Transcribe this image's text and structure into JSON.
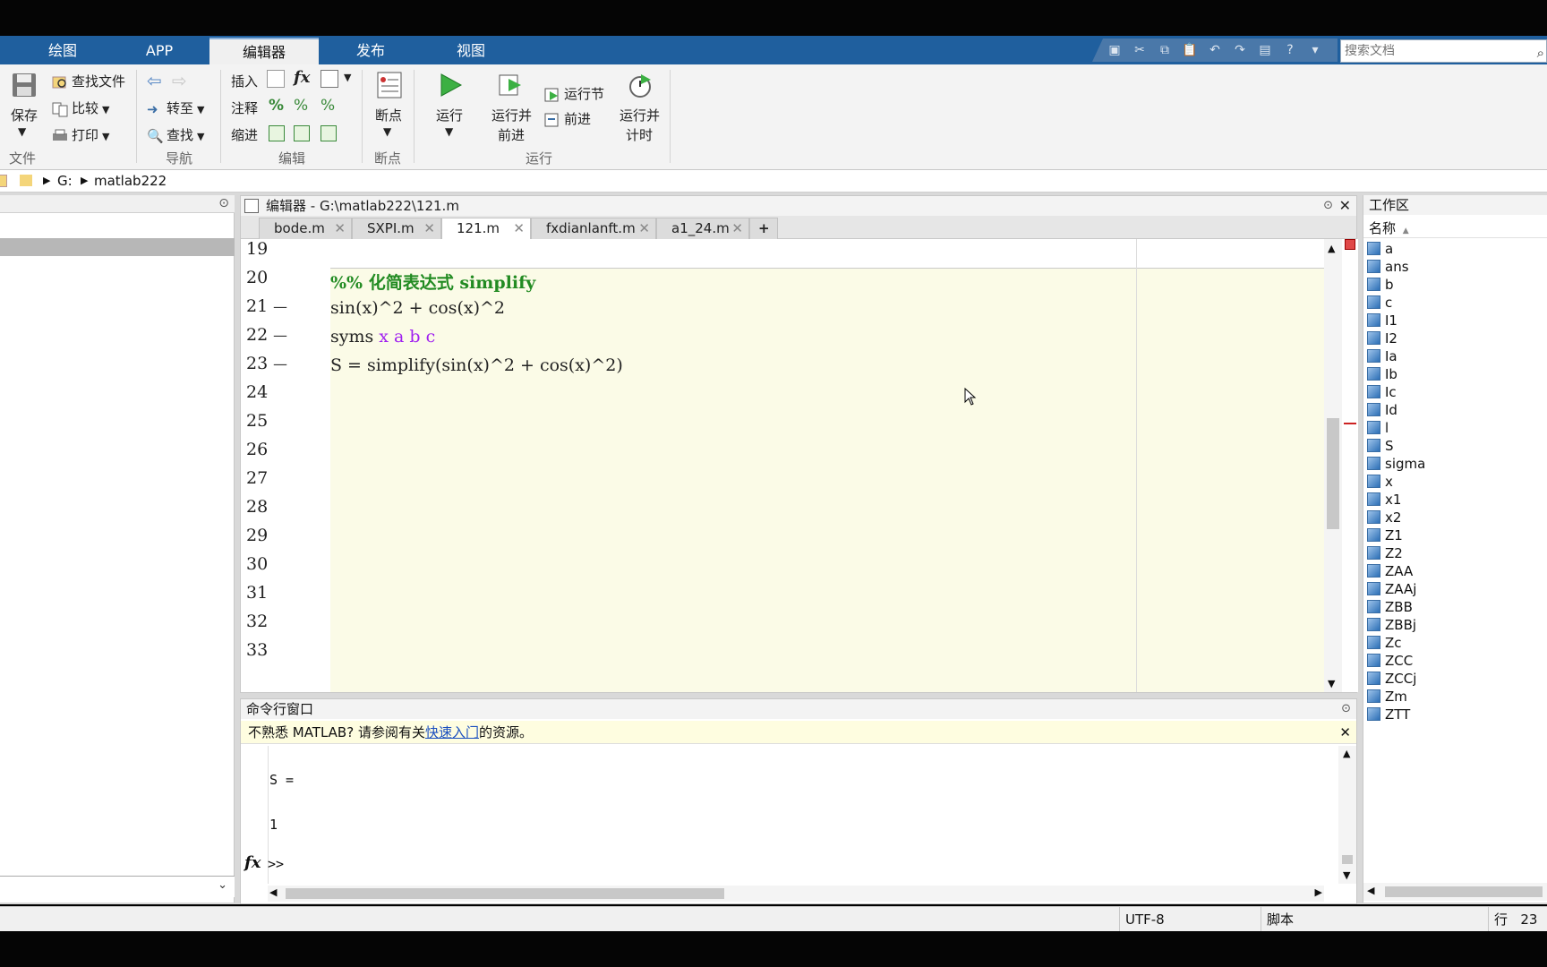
{
  "ribbon_tabs": [
    {
      "label": "绘图"
    },
    {
      "label": "APP"
    },
    {
      "label": "编辑器"
    },
    {
      "label": "发布"
    },
    {
      "label": "视图"
    }
  ],
  "search": {
    "placeholder": "搜索文档"
  },
  "ribbon": {
    "file": {
      "save": "保存",
      "find_files": "查找文件",
      "compare": "比较",
      "print": "打印",
      "group": "文件"
    },
    "nav": {
      "goto": "转至",
      "find": "查找",
      "group": "导航"
    },
    "edit": {
      "insert": "插入",
      "comment": "注释",
      "indent": "缩进",
      "group": "编辑",
      "fx": "fx"
    },
    "breakpoints": {
      "label": "断点",
      "group": "断点"
    },
    "run": {
      "run": "运行",
      "run_advance_1": "运行并",
      "run_advance_2": "前进",
      "run_section": "运行节",
      "advance": "前进",
      "run_time_1": "运行并",
      "run_time_2": "计时",
      "group": "运行"
    }
  },
  "address": {
    "drive": "G:",
    "folder": "matlab222"
  },
  "editor": {
    "title": "编辑器 - G:\\matlab222\\121.m",
    "tabs": [
      {
        "label": "bode.m"
      },
      {
        "label": "SXPI.m"
      },
      {
        "label": "121.m"
      },
      {
        "label": "fxdianlanft.m"
      },
      {
        "label": "a1_24.m"
      }
    ],
    "add_tab": "+",
    "line_numbers": [
      "19",
      "20",
      "21",
      "22",
      "23",
      "24",
      "25",
      "26",
      "27",
      "28",
      "29",
      "30",
      "31",
      "32",
      "33"
    ],
    "exec_marks": [
      "—",
      "—",
      "—"
    ],
    "code": {
      "l20": "%% 化简表达式 simplify",
      "l21": "sin(x)^2 + cos(x)^2",
      "l22_kw": "syms ",
      "l22_syms": "x a b c",
      "l23": "S = simplify(sin(x)^2 + cos(x)^2)"
    }
  },
  "command": {
    "title": "命令行窗口",
    "info_pre": "不熟悉 MATLAB? 请参阅有关",
    "info_link": "快速入门",
    "info_post": "的资源。",
    "out_var": "S =",
    "out_val": "1",
    "fx": "fx",
    "prompt": ">>"
  },
  "workspace": {
    "title": "工作区",
    "column": "名称",
    "variables": [
      "a",
      "ans",
      "b",
      "c",
      "I1",
      "I2",
      "Ia",
      "Ib",
      "Ic",
      "Id",
      "l",
      "S",
      "sigma",
      "x",
      "x1",
      "x2",
      "Z1",
      "Z2",
      "ZAA",
      "ZAAj",
      "ZBB",
      "ZBBj",
      "Zc",
      "ZCC",
      "ZCCj",
      "Zm",
      "ZTT"
    ]
  },
  "status": {
    "encoding": "UTF-8",
    "type": "脚本",
    "row_label": "行",
    "row": "23"
  },
  "colors": {
    "ribbon_tab_bg": "#1f5f9e",
    "comment": "#228b22",
    "symbol": "#a020f0",
    "cell_bg": "#fbfbe7"
  }
}
